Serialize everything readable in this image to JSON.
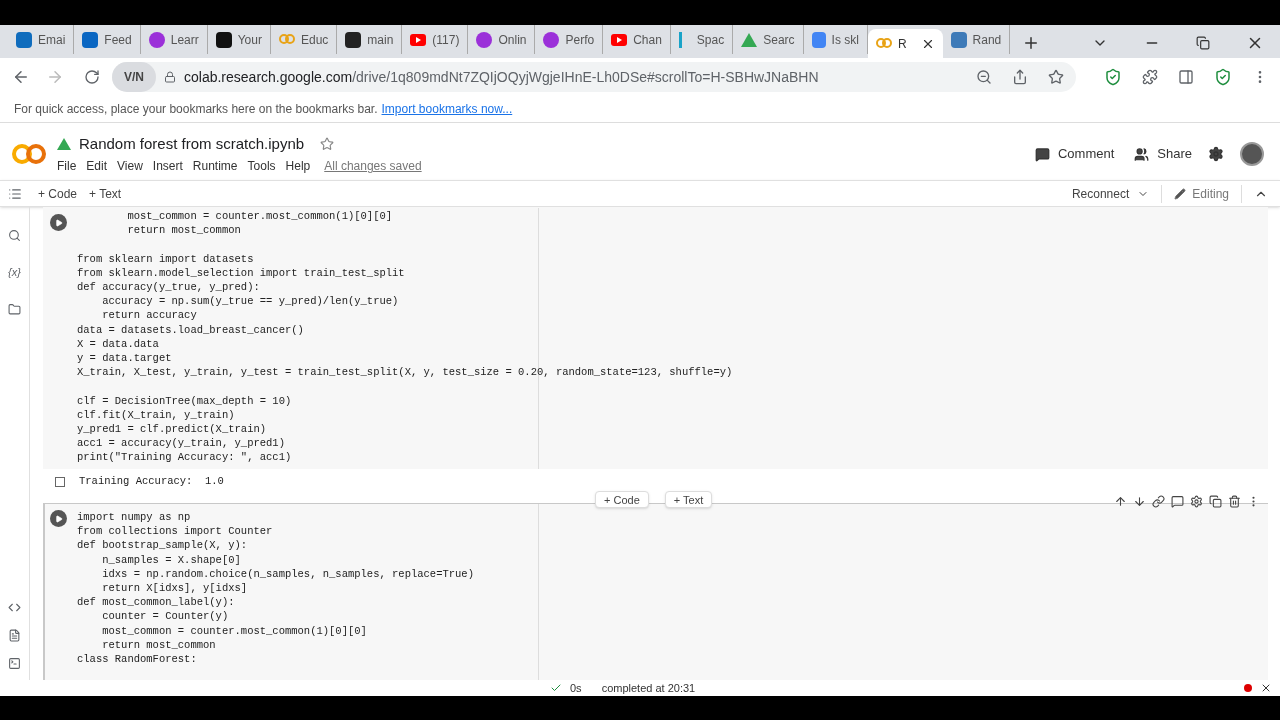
{
  "browser": {
    "tabs": [
      {
        "label": "Emai",
        "kind": "mail",
        "color": "#0f6cbd",
        "selected": false
      },
      {
        "label": "Feed",
        "kind": "square",
        "color": "#0a66c2",
        "selected": false
      },
      {
        "label": "Learr",
        "kind": "circle",
        "color": "#9b30d9",
        "selected": false
      },
      {
        "label": "Your",
        "kind": "square",
        "color": "#111111",
        "selected": false
      },
      {
        "label": "Educ",
        "kind": "co",
        "color": "#e8a317",
        "selected": false
      },
      {
        "label": "main",
        "kind": "square",
        "color": "#222222",
        "selected": false
      },
      {
        "label": "(117)",
        "kind": "play",
        "color": "#ff0000",
        "selected": false
      },
      {
        "label": "Onlin",
        "kind": "circle",
        "color": "#9b30d9",
        "selected": false
      },
      {
        "label": "Perfo",
        "kind": "circle",
        "color": "#9b30d9",
        "selected": false
      },
      {
        "label": "Chan",
        "kind": "play",
        "color": "#ff0000",
        "selected": false
      },
      {
        "label": "Spac",
        "kind": "letter",
        "color": "#1aa3c8",
        "selected": false
      },
      {
        "label": "Searc",
        "kind": "drive",
        "color": "#34a853",
        "selected": false
      },
      {
        "label": "Is skl",
        "kind": "doc",
        "color": "#4285f4",
        "selected": false
      },
      {
        "label": "R",
        "kind": "co",
        "color": "#e8a317",
        "selected": true
      },
      {
        "label": "Rand",
        "kind": "square",
        "color": "#3d7ab8",
        "selected": false
      }
    ],
    "url_host": "colab.research.google.com",
    "url_path": "/drive/1q809mdNt7ZQIjOQyjWgjeIHnE-Lh0DSe#scrollTo=H-SBHwJNaBHN",
    "vpn_badge": "V/N",
    "bookmarks_hint": "For quick access, place your bookmarks here on the bookmarks bar.",
    "bookmarks_link": "Import bookmarks now..."
  },
  "colab": {
    "title": "Random forest from scratch.ipynb",
    "menu": [
      "File",
      "Edit",
      "View",
      "Insert",
      "Runtime",
      "Tools",
      "Help"
    ],
    "save_status": "All changes saved",
    "comment": "Comment",
    "share": "Share",
    "add_code": "+ Code",
    "add_text": "+ Text",
    "reconnect": "Reconnect",
    "editing": "Editing",
    "sidebar_var": "{x}"
  },
  "cells": [
    {
      "blocks": [
        [
          "        most_common = counter.most_common(1)[0][0]",
          "        return most_common"
        ],
        [
          "from sklearn import datasets",
          "from sklearn.model_selection import train_test_split",
          "def accuracy(y_true, y_pred):",
          "    accuracy = np.sum(y_true == y_pred)/len(y_true)",
          "    return accuracy",
          "data = datasets.load_breast_cancer()",
          "X = data.data",
          "y = data.target",
          "X_train, X_test, y_train, y_test = train_test_split(X, y, test_size = 0.20, random_state=123, shuffle=y)"
        ],
        [
          "clf = DecisionTree(max_depth = 10)",
          "clf.fit(X_train, y_train)",
          "y_pred1 = clf.predict(X_train)",
          "acc1 = accuracy(y_train, y_pred1)",
          "print(\"Training Accuracy: \", acc1)"
        ]
      ],
      "output": "Training Accuracy:  1.0",
      "selected": false
    },
    {
      "blocks": [
        [
          "import numpy as np",
          "from collections import Counter",
          "def bootstrap_sample(X, y):",
          "    n_samples = X.shape[0]",
          "    idxs = np.random.choice(n_samples, n_samples, replace=True)",
          "    return X[idxs], y[idxs]",
          "def most_common_label(y):",
          "    counter = Counter(y)",
          "    most_common = counter.most_common(1)[0][0]",
          "    return most_common",
          "class RandomForest:"
        ]
      ],
      "selected": true
    }
  ],
  "insert_bar": {
    "code": "+ Code",
    "text": "+ Text"
  },
  "status": {
    "duration": "0s",
    "message": "completed at 20:31"
  }
}
